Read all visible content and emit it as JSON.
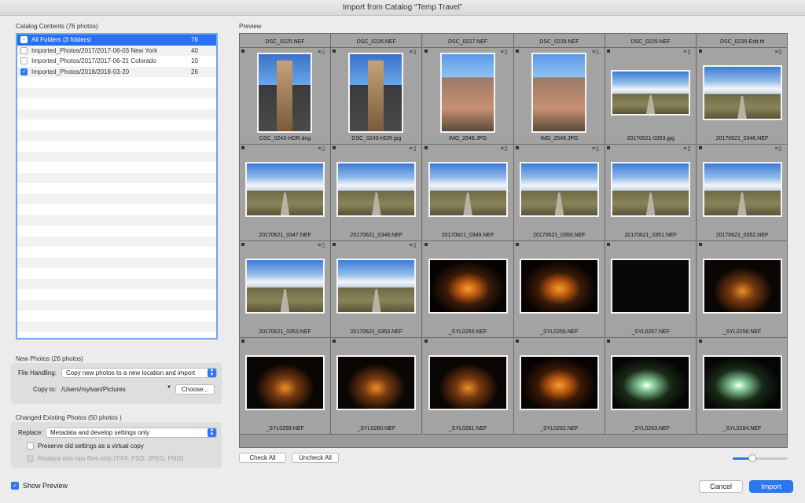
{
  "window": {
    "title": "Import from Catalog “Temp Travel”"
  },
  "catalog": {
    "title": "Catalog Contents (76 photos)",
    "folders": [
      {
        "name": "All Folders (3 folders)",
        "count": "76",
        "state": "mixed",
        "selected": true
      },
      {
        "name": "Imported_Photos/2017/2017-06-03 New York",
        "count": "40",
        "state": "off"
      },
      {
        "name": "Imported_Photos/2017/2017-06-21 Colorado",
        "count": "10",
        "state": "off"
      },
      {
        "name": "Imported_Photos/2018/2018-03-20",
        "count": "26",
        "state": "on"
      }
    ]
  },
  "new_photos": {
    "title": "New Photos (26 photos)",
    "file_handling_label": "File Handling:",
    "file_handling_value": "Copy new photos to a new location and import",
    "copy_to_label": "Copy to:",
    "copy_to_path": "/Users/rsylvan/Pictures",
    "choose_label": "Choose..."
  },
  "changed": {
    "title": "Changed Existing Photos (50 photos )",
    "replace_label": "Replace:",
    "replace_value": "Metadata and develop settings only",
    "preserve_label": "Preserve old settings as a virtual copy",
    "replace_nonraw_label": "Replace non-raw files only (TIFF, PSD, JPEG, PNG)"
  },
  "preview": {
    "title": "Preview",
    "top_row": [
      "DSC_0225.NEF",
      "DSC_0226.NEF",
      "DSC_0227.NEF",
      "DSC_0228.NEF",
      "DSC_0229.NEF",
      "DSC_0235-Edit.tif"
    ],
    "rows": [
      [
        {
          "name": "DSC_0243-HDR.dng",
          "kind": "flat",
          "orient": "portrait"
        },
        {
          "name": "DSC_0243-HDR.jpg",
          "kind": "flat",
          "orient": "portrait"
        },
        {
          "name": "IMG_2548.JPG",
          "kind": "city",
          "orient": "portrait"
        },
        {
          "name": "IMG_2549.JPG",
          "kind": "city",
          "orient": "portrait"
        },
        {
          "name": "20170621-0353.jpg",
          "kind": "road",
          "orient": "landscape-thin"
        },
        {
          "name": "20170621_0346.NEF",
          "kind": "road",
          "orient": "landscape"
        }
      ],
      [
        {
          "name": "20170621_0347.NEF",
          "kind": "road",
          "orient": "landscape"
        },
        {
          "name": "20170621_0348.NEF",
          "kind": "road",
          "orient": "landscape"
        },
        {
          "name": "20170621_0349.NEF",
          "kind": "road",
          "orient": "landscape"
        },
        {
          "name": "20170621_0350.NEF",
          "kind": "road",
          "orient": "landscape"
        },
        {
          "name": "20170621_0351.NEF",
          "kind": "road",
          "orient": "landscape"
        },
        {
          "name": "20170621_0352.NEF",
          "kind": "road",
          "orient": "landscape"
        }
      ],
      [
        {
          "name": "20170621_0353.NEF",
          "kind": "road",
          "orient": "landscape"
        },
        {
          "name": "20170621_0353.NEF",
          "kind": "road",
          "orient": "landscape"
        },
        {
          "name": "_SYL0255.NEF",
          "kind": "fire",
          "orient": "landscape"
        },
        {
          "name": "_SYL0256.NEF",
          "kind": "fire",
          "orient": "landscape"
        },
        {
          "name": "_SYL0257.NEF",
          "kind": "dark",
          "orient": "landscape"
        },
        {
          "name": "_SYL0258.NEF",
          "kind": "ring",
          "orient": "landscape"
        }
      ],
      [
        {
          "name": "_SYL0259.NEF",
          "kind": "ring",
          "orient": "landscape"
        },
        {
          "name": "_SYL0260.NEF",
          "kind": "ring",
          "orient": "landscape"
        },
        {
          "name": "_SYL0261.NEF",
          "kind": "ring",
          "orient": "landscape"
        },
        {
          "name": "_SYL0262.NEF",
          "kind": "fire",
          "orient": "landscape"
        },
        {
          "name": "_SYL0263.NEF",
          "kind": "white",
          "orient": "landscape"
        },
        {
          "name": "_SYL0264.NEF",
          "kind": "white",
          "orient": "landscape"
        }
      ]
    ],
    "check_all_label": "Check All",
    "uncheck_all_label": "Uncheck All",
    "thumb_size_level": 0.35
  },
  "footer": {
    "show_preview_label": "Show Preview",
    "cancel_label": "Cancel",
    "import_label": "Import"
  },
  "colors": {
    "accent": "#2a78f0"
  }
}
